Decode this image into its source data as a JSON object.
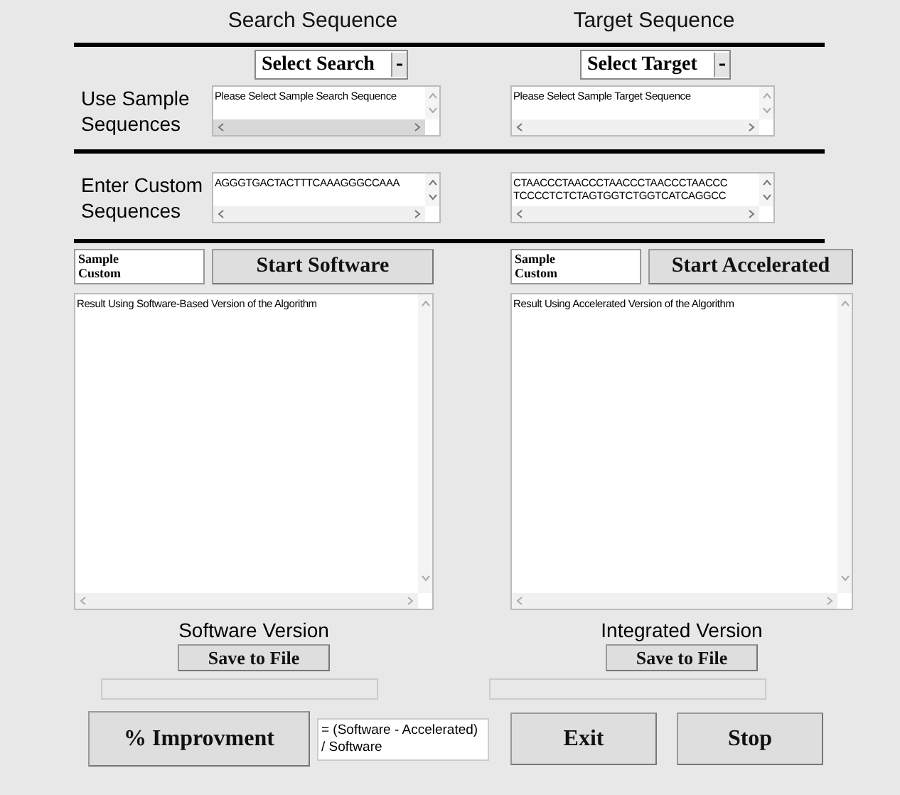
{
  "columns": [
    {
      "heading": "Search Sequence",
      "dropdown": "Select Search",
      "sample_text": "Please Select Sample Search Sequence",
      "custom_lines": [
        "AGGGTGACTACTTTCAAAGGGCCAAA"
      ],
      "listbox": [
        "Sample",
        "Custom"
      ],
      "start_button": "Start Software",
      "result": "Result Using Software-Based Version of the Algorithm",
      "version_label": "Software Version",
      "save_button": "Save to File"
    },
    {
      "heading": "Target Sequence",
      "dropdown": "Select Target",
      "sample_text": "Please Select Sample Target Sequence",
      "custom_lines": [
        "CTAACCCTAACCCTAACCCTAACCCTAACCC",
        "TCCCCTCTCTAGTGGTCTGGTCATCAGGCC"
      ],
      "listbox": [
        "Sample",
        "Custom"
      ],
      "start_button": "Start Accelerated",
      "result": "Result Using Accelerated Version of the Algorithm",
      "version_label": "Integrated Version",
      "save_button": "Save to File"
    }
  ],
  "row_labels": {
    "sample": "Use Sample Sequences",
    "custom": "Enter Custom Sequences"
  },
  "improvement_button": "% Improvment",
  "formula": "= (Software - Accelerated) / Software",
  "buttons": [
    "Exit",
    "Stop"
  ]
}
